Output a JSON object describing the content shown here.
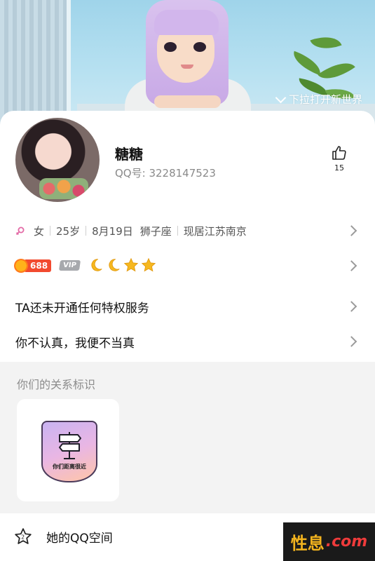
{
  "banner": {
    "hint": "下拉打开新世界"
  },
  "profile": {
    "name": "糖糖",
    "qq_label": "QQ号: ",
    "qq_number": "3228147523",
    "likes": "15"
  },
  "info": {
    "gender": "女",
    "age": "25岁",
    "birthday": "8月19日",
    "zodiac": "狮子座",
    "location": "现居江苏南京"
  },
  "badges": {
    "level": "688",
    "vip": "VIP"
  },
  "privilege": {
    "text": "TA还未开通任何特权服务"
  },
  "signature": {
    "text": "你不认真，我便不当真"
  },
  "relationship": {
    "section_title": "你们的关系标识",
    "tag_label": "你们距离很近"
  },
  "bottom": {
    "qzone_label": "她的QQ空间"
  },
  "watermark": {
    "cn": "性息",
    "dot": ".com"
  },
  "colors": {
    "level_red": "#f24a2f",
    "vip_gray": "#a7a9ad",
    "gold": "#f2b31e",
    "watermark_red": "#ee3b3b"
  }
}
